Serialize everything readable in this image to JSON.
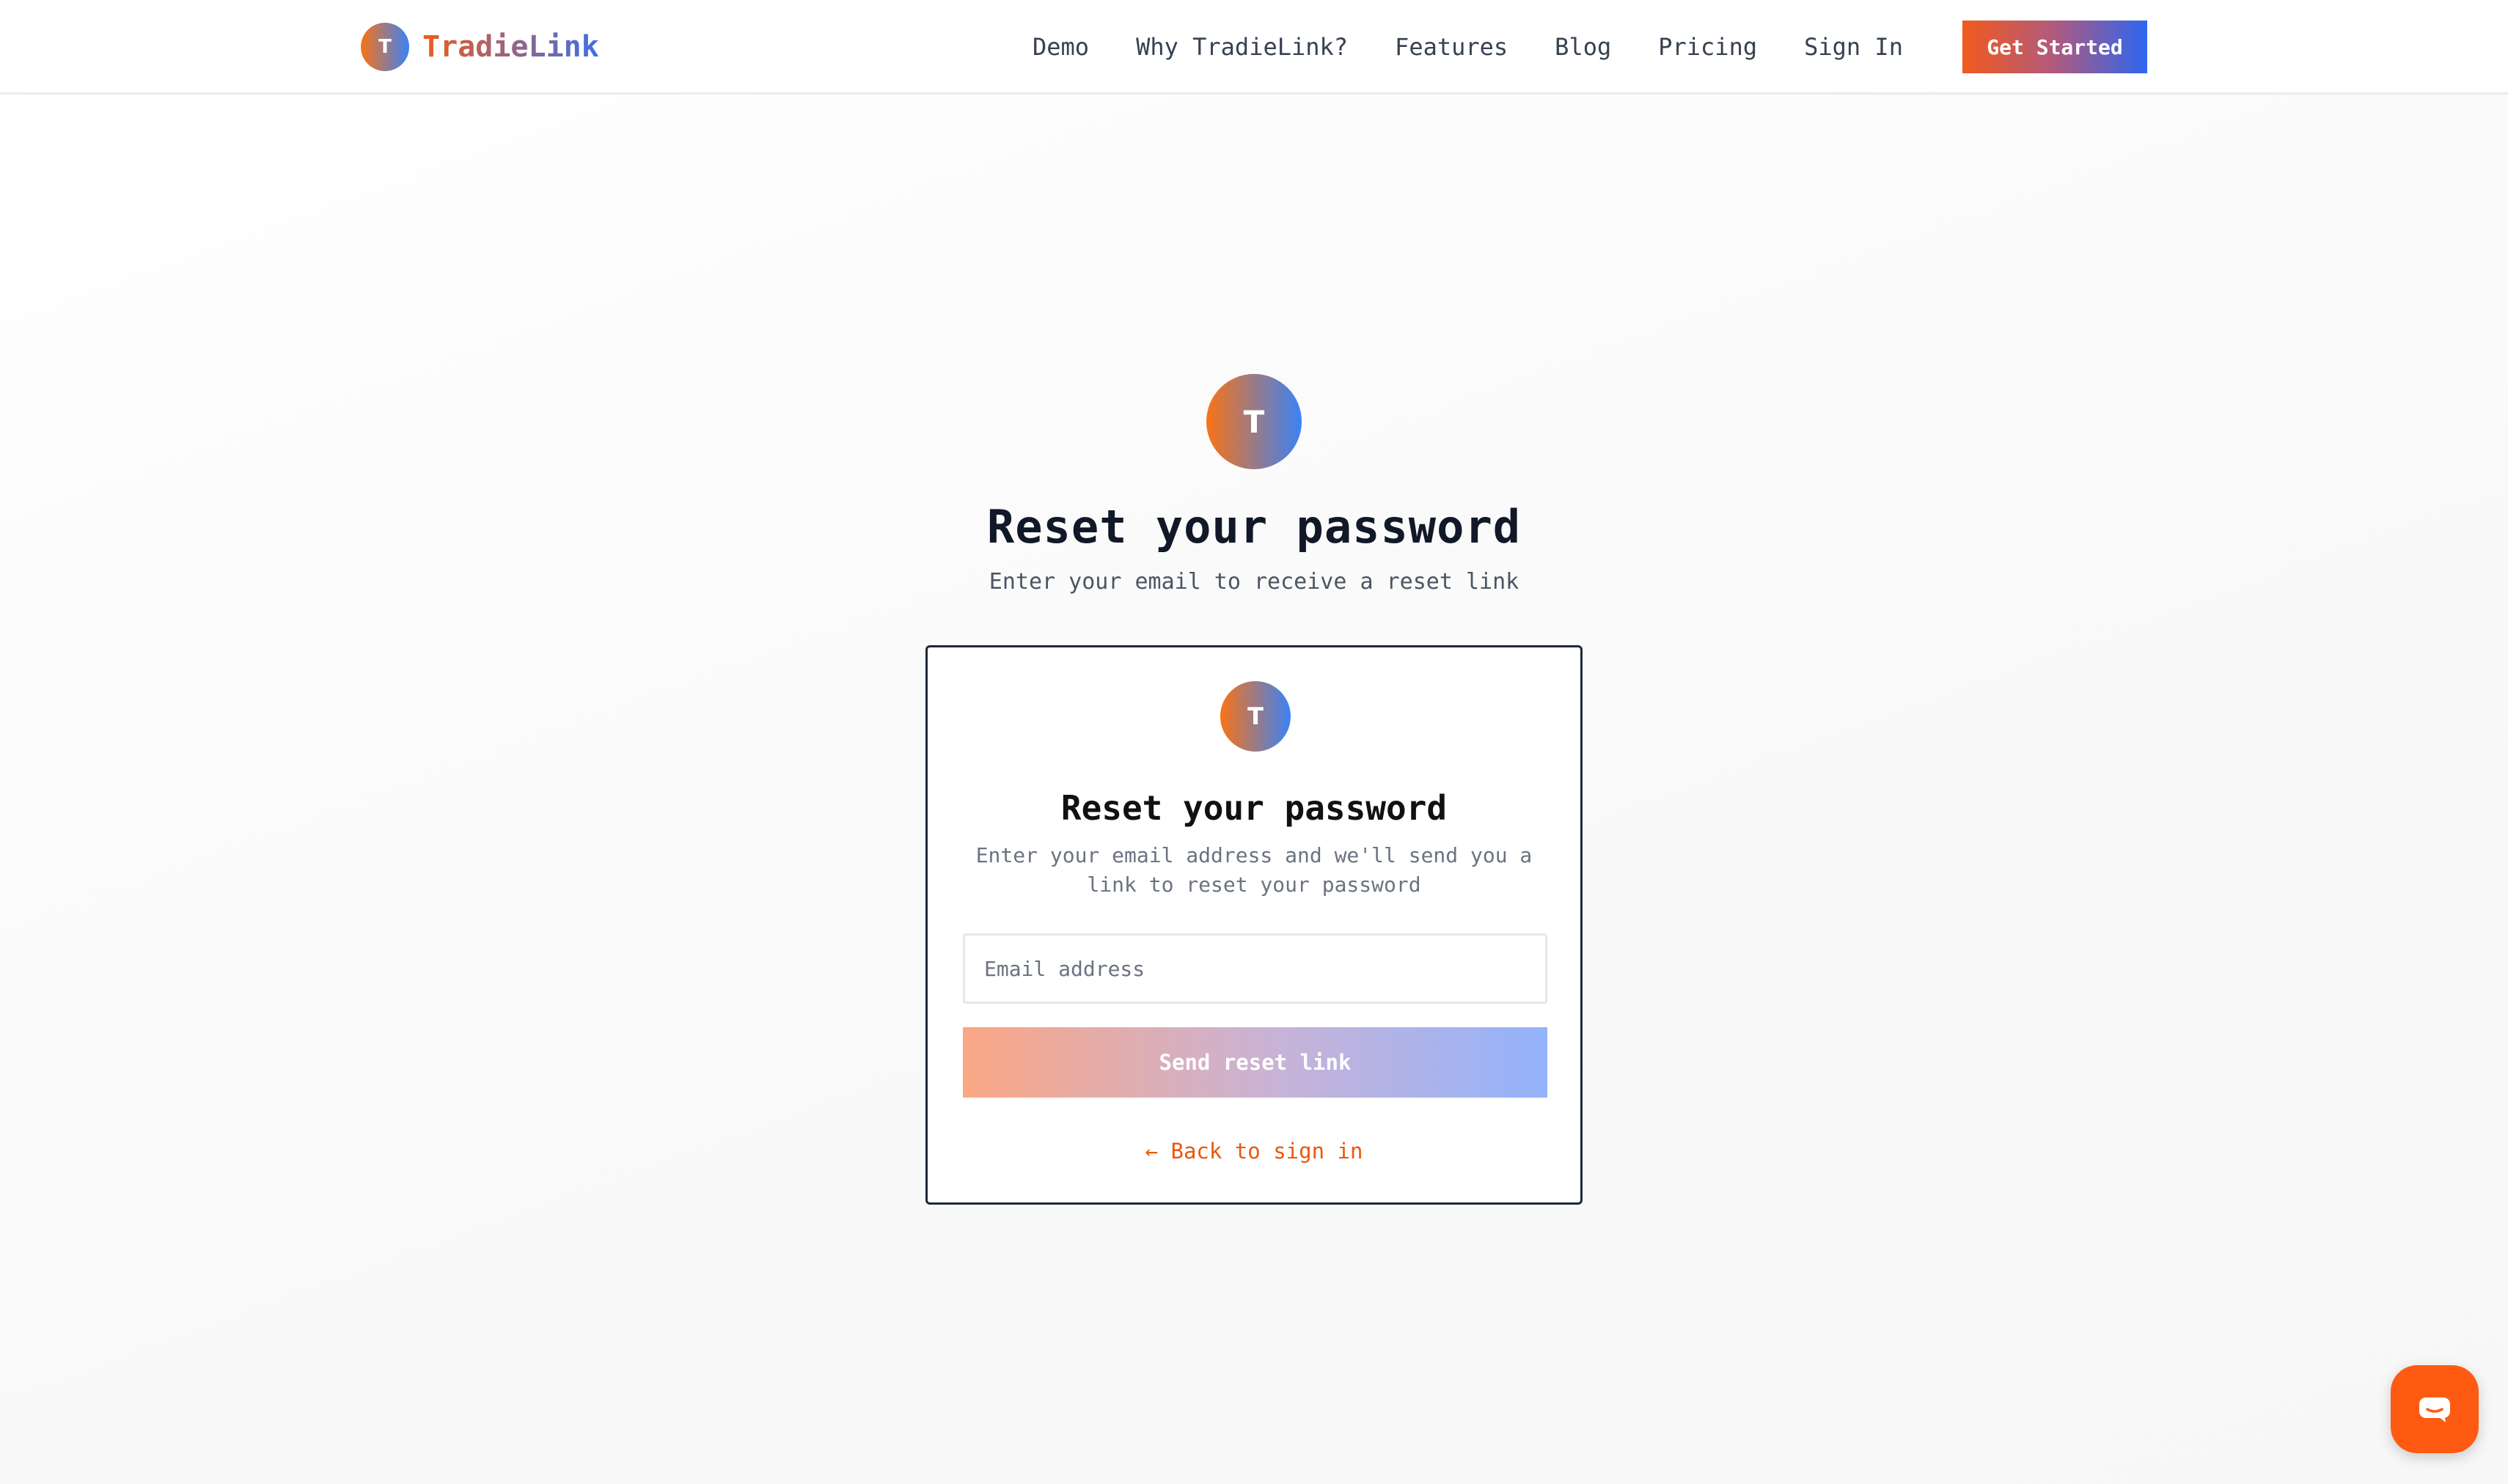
{
  "header": {
    "brand": {
      "logo_letter": "T",
      "name": "TradieLink"
    },
    "nav": [
      {
        "label": "Demo"
      },
      {
        "label": "Why TradieLink?"
      },
      {
        "label": "Features"
      },
      {
        "label": "Blog"
      },
      {
        "label": "Pricing"
      },
      {
        "label": "Sign In"
      }
    ],
    "cta_label": "Get Started"
  },
  "hero": {
    "logo_letter": "T",
    "title": "Reset your password",
    "subtitle": "Enter your email to receive a reset link"
  },
  "card": {
    "logo_letter": "T",
    "title": "Reset your password",
    "description": "Enter your email address and we'll send you a link to reset your password",
    "email": {
      "value": "",
      "placeholder": "Email address"
    },
    "submit_label": "Send reset link",
    "back_link": "← Back to sign in"
  },
  "chat": {
    "icon": "chat-bubble-icon"
  },
  "colors": {
    "brand_orange": "#f97316",
    "brand_blue": "#3b82f6",
    "link_orange": "#ea580c",
    "chat_orange": "#ff5a12",
    "heading": "#111827"
  }
}
